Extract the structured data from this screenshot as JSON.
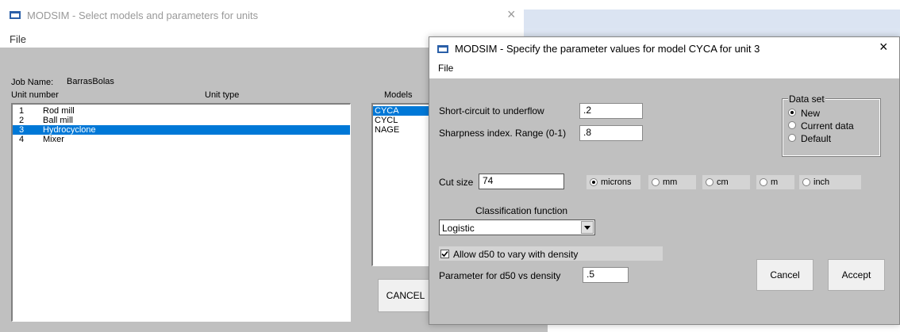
{
  "back_window": {
    "title": "MODSIM - Select models and parameters for units",
    "menu_file": "File",
    "close_glyph": "×",
    "job_name_label": "Job Name:",
    "job_name_value": "BarrasBolas",
    "unit_number_header": "Unit number",
    "unit_type_header": "Unit type",
    "models_header": "Models",
    "units": [
      {
        "num": "1",
        "name": "Rod mill"
      },
      {
        "num": "2",
        "name": "Ball mill"
      },
      {
        "num": "3",
        "name": "Hydrocyclone"
      },
      {
        "num": "4",
        "name": "Mixer"
      }
    ],
    "models": [
      "CYCA",
      "CYCL",
      "NAGE"
    ],
    "cancel_label": "CANCEL"
  },
  "front_window": {
    "title": "MODSIM - Specify the parameter values for model CYCA for unit 3",
    "menu_file": "File",
    "close_glyph": "×",
    "short_circuit_label": "Short-circuit to underflow",
    "short_circuit_value": ".2",
    "sharpness_label": "Sharpness index.  Range (0-1)",
    "sharpness_value": ".8",
    "data_set_title": "Data set",
    "data_set_options": [
      "New",
      "Current data",
      "Default"
    ],
    "cut_size_label": "Cut size",
    "cut_size_value": "74",
    "units": [
      "microns",
      "mm",
      "cm",
      "m",
      "inch"
    ],
    "classification_label": "Classification function",
    "classification_value": "Logistic",
    "allow_d50_label": "Allow d50 to vary with density",
    "param_d50_label": "Parameter for d50 vs density",
    "param_d50_value": ".5",
    "cancel_label": "Cancel",
    "accept_label": "Accept"
  },
  "colors": {
    "selection": "#0078d7",
    "panel_gray": "#c0c0c0"
  }
}
